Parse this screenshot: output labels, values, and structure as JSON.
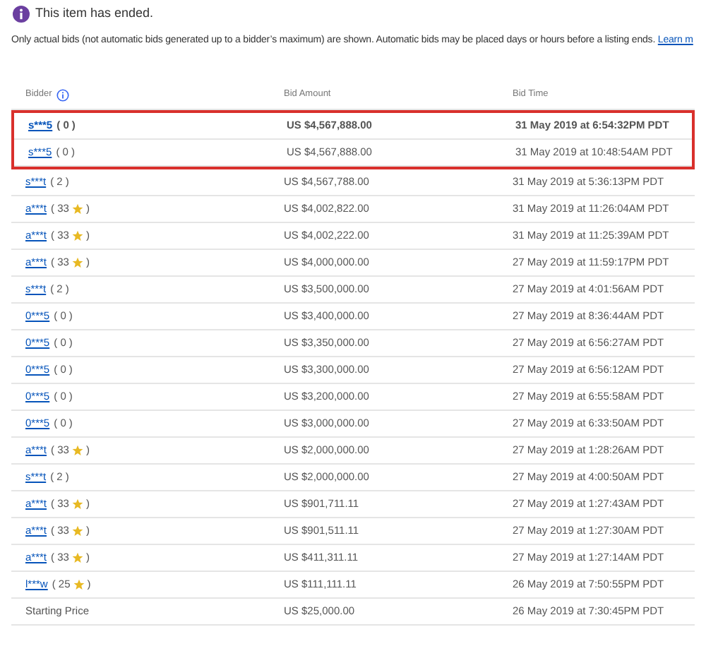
{
  "notice": {
    "text": "This item has ended."
  },
  "note": {
    "text": "Only actual bids (not automatic bids generated up to a bidder’s maximum) are shown. Automatic bids may be placed days or hours before a listing ends.",
    "link": "Learn m"
  },
  "table": {
    "columns": [
      "Bidder",
      "Bid Amount",
      "Bid Time"
    ],
    "rows": [
      {
        "kind": "bidder",
        "name": "s***5",
        "feedback": "( 0",
        "feedback_end": ")",
        "star": false,
        "highlighted": true,
        "winning": true,
        "amount": "US $4,567,888.00",
        "time": "31 May 2019 at 6:54:32PM PDT"
      },
      {
        "kind": "bidder",
        "name": "s***5",
        "feedback": "( 0",
        "feedback_end": ")",
        "star": false,
        "highlighted": true,
        "winning": false,
        "amount": "US $4,567,888.00",
        "time": "31 May 2019 at 10:48:54AM PDT"
      },
      {
        "kind": "bidder",
        "name": "s***t",
        "feedback": "( 2",
        "feedback_end": ")",
        "star": false,
        "highlighted": false,
        "winning": false,
        "amount": "US $4,567,788.00",
        "time": "31 May 2019 at 5:36:13PM PDT"
      },
      {
        "kind": "bidder",
        "name": "a***t",
        "feedback": "( 33",
        "feedback_end": ")",
        "star": true,
        "highlighted": false,
        "winning": false,
        "amount": "US $4,002,822.00",
        "time": "31 May 2019 at 11:26:04AM PDT"
      },
      {
        "kind": "bidder",
        "name": "a***t",
        "feedback": "( 33",
        "feedback_end": ")",
        "star": true,
        "highlighted": false,
        "winning": false,
        "amount": "US $4,002,222.00",
        "time": "31 May 2019 at 11:25:39AM PDT"
      },
      {
        "kind": "bidder",
        "name": "a***t",
        "feedback": "( 33",
        "feedback_end": ")",
        "star": true,
        "highlighted": false,
        "winning": false,
        "amount": "US $4,000,000.00",
        "time": "27 May 2019 at 11:59:17PM PDT"
      },
      {
        "kind": "bidder",
        "name": "s***t",
        "feedback": "( 2",
        "feedback_end": ")",
        "star": false,
        "highlighted": false,
        "winning": false,
        "amount": "US $3,500,000.00",
        "time": "27 May 2019 at 4:01:56AM PDT"
      },
      {
        "kind": "bidder",
        "name": "0***5",
        "feedback": "( 0",
        "feedback_end": ")",
        "star": false,
        "highlighted": false,
        "winning": false,
        "amount": "US $3,400,000.00",
        "time": "27 May 2019 at 8:36:44AM PDT"
      },
      {
        "kind": "bidder",
        "name": "0***5",
        "feedback": "( 0",
        "feedback_end": ")",
        "star": false,
        "highlighted": false,
        "winning": false,
        "amount": "US $3,350,000.00",
        "time": "27 May 2019 at 6:56:27AM PDT"
      },
      {
        "kind": "bidder",
        "name": "0***5",
        "feedback": "( 0",
        "feedback_end": ")",
        "star": false,
        "highlighted": false,
        "winning": false,
        "amount": "US $3,300,000.00",
        "time": "27 May 2019 at 6:56:12AM PDT"
      },
      {
        "kind": "bidder",
        "name": "0***5",
        "feedback": "( 0",
        "feedback_end": ")",
        "star": false,
        "highlighted": false,
        "winning": false,
        "amount": "US $3,200,000.00",
        "time": "27 May 2019 at 6:55:58AM PDT"
      },
      {
        "kind": "bidder",
        "name": "0***5",
        "feedback": "( 0",
        "feedback_end": ")",
        "star": false,
        "highlighted": false,
        "winning": false,
        "amount": "US $3,000,000.00",
        "time": "27 May 2019 at 6:33:50AM PDT"
      },
      {
        "kind": "bidder",
        "name": "a***t",
        "feedback": "( 33",
        "feedback_end": ")",
        "star": true,
        "highlighted": false,
        "winning": false,
        "amount": "US $2,000,000.00",
        "time": "27 May 2019 at 1:28:26AM PDT"
      },
      {
        "kind": "bidder",
        "name": "s***t",
        "feedback": "( 2",
        "feedback_end": ")",
        "star": false,
        "highlighted": false,
        "winning": false,
        "amount": "US $2,000,000.00",
        "time": "27 May 2019 at 4:00:50AM PDT"
      },
      {
        "kind": "bidder",
        "name": "a***t",
        "feedback": "( 33",
        "feedback_end": ")",
        "star": true,
        "highlighted": false,
        "winning": false,
        "amount": "US $901,711.11",
        "time": "27 May 2019 at 1:27:43AM PDT"
      },
      {
        "kind": "bidder",
        "name": "a***t",
        "feedback": "( 33",
        "feedback_end": ")",
        "star": true,
        "highlighted": false,
        "winning": false,
        "amount": "US $901,511.11",
        "time": "27 May 2019 at 1:27:30AM PDT"
      },
      {
        "kind": "bidder",
        "name": "a***t",
        "feedback": "( 33",
        "feedback_end": ")",
        "star": true,
        "highlighted": false,
        "winning": false,
        "amount": "US $411,311.11",
        "time": "27 May 2019 at 1:27:14AM PDT"
      },
      {
        "kind": "bidder",
        "name": "l***w",
        "feedback": "( 25",
        "feedback_end": ")",
        "star": true,
        "highlighted": false,
        "winning": false,
        "amount": "US $111,111.11",
        "time": "26 May 2019 at 7:50:55PM PDT"
      },
      {
        "kind": "start",
        "name": "Starting Price",
        "amount": "US $25,000.00",
        "time": "26 May 2019 at 7:30:45PM PDT"
      }
    ]
  }
}
